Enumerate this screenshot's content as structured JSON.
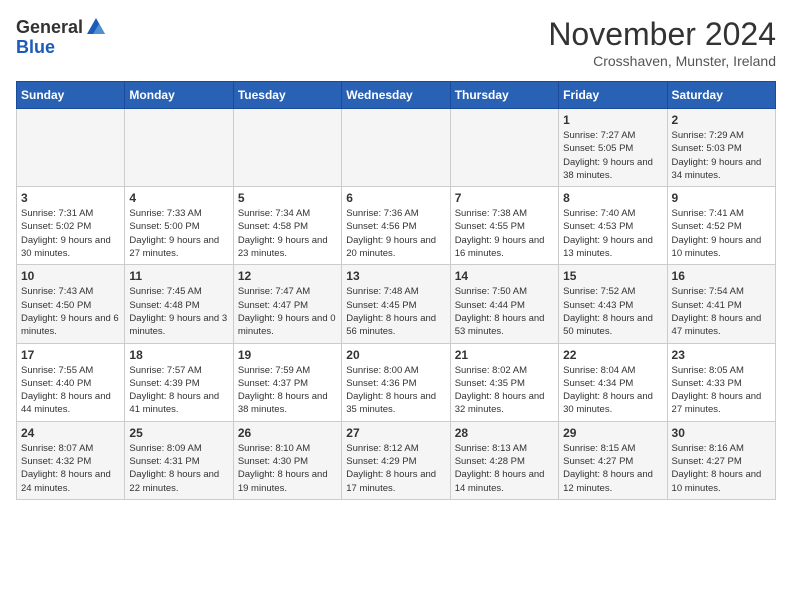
{
  "logo": {
    "general": "General",
    "blue": "Blue"
  },
  "title": "November 2024",
  "subtitle": "Crosshaven, Munster, Ireland",
  "headers": [
    "Sunday",
    "Monday",
    "Tuesday",
    "Wednesday",
    "Thursday",
    "Friday",
    "Saturday"
  ],
  "weeks": [
    [
      {
        "day": "",
        "info": ""
      },
      {
        "day": "",
        "info": ""
      },
      {
        "day": "",
        "info": ""
      },
      {
        "day": "",
        "info": ""
      },
      {
        "day": "",
        "info": ""
      },
      {
        "day": "1",
        "info": "Sunrise: 7:27 AM\nSunset: 5:05 PM\nDaylight: 9 hours and 38 minutes."
      },
      {
        "day": "2",
        "info": "Sunrise: 7:29 AM\nSunset: 5:03 PM\nDaylight: 9 hours and 34 minutes."
      }
    ],
    [
      {
        "day": "3",
        "info": "Sunrise: 7:31 AM\nSunset: 5:02 PM\nDaylight: 9 hours and 30 minutes."
      },
      {
        "day": "4",
        "info": "Sunrise: 7:33 AM\nSunset: 5:00 PM\nDaylight: 9 hours and 27 minutes."
      },
      {
        "day": "5",
        "info": "Sunrise: 7:34 AM\nSunset: 4:58 PM\nDaylight: 9 hours and 23 minutes."
      },
      {
        "day": "6",
        "info": "Sunrise: 7:36 AM\nSunset: 4:56 PM\nDaylight: 9 hours and 20 minutes."
      },
      {
        "day": "7",
        "info": "Sunrise: 7:38 AM\nSunset: 4:55 PM\nDaylight: 9 hours and 16 minutes."
      },
      {
        "day": "8",
        "info": "Sunrise: 7:40 AM\nSunset: 4:53 PM\nDaylight: 9 hours and 13 minutes."
      },
      {
        "day": "9",
        "info": "Sunrise: 7:41 AM\nSunset: 4:52 PM\nDaylight: 9 hours and 10 minutes."
      }
    ],
    [
      {
        "day": "10",
        "info": "Sunrise: 7:43 AM\nSunset: 4:50 PM\nDaylight: 9 hours and 6 minutes."
      },
      {
        "day": "11",
        "info": "Sunrise: 7:45 AM\nSunset: 4:48 PM\nDaylight: 9 hours and 3 minutes."
      },
      {
        "day": "12",
        "info": "Sunrise: 7:47 AM\nSunset: 4:47 PM\nDaylight: 9 hours and 0 minutes."
      },
      {
        "day": "13",
        "info": "Sunrise: 7:48 AM\nSunset: 4:45 PM\nDaylight: 8 hours and 56 minutes."
      },
      {
        "day": "14",
        "info": "Sunrise: 7:50 AM\nSunset: 4:44 PM\nDaylight: 8 hours and 53 minutes."
      },
      {
        "day": "15",
        "info": "Sunrise: 7:52 AM\nSunset: 4:43 PM\nDaylight: 8 hours and 50 minutes."
      },
      {
        "day": "16",
        "info": "Sunrise: 7:54 AM\nSunset: 4:41 PM\nDaylight: 8 hours and 47 minutes."
      }
    ],
    [
      {
        "day": "17",
        "info": "Sunrise: 7:55 AM\nSunset: 4:40 PM\nDaylight: 8 hours and 44 minutes."
      },
      {
        "day": "18",
        "info": "Sunrise: 7:57 AM\nSunset: 4:39 PM\nDaylight: 8 hours and 41 minutes."
      },
      {
        "day": "19",
        "info": "Sunrise: 7:59 AM\nSunset: 4:37 PM\nDaylight: 8 hours and 38 minutes."
      },
      {
        "day": "20",
        "info": "Sunrise: 8:00 AM\nSunset: 4:36 PM\nDaylight: 8 hours and 35 minutes."
      },
      {
        "day": "21",
        "info": "Sunrise: 8:02 AM\nSunset: 4:35 PM\nDaylight: 8 hours and 32 minutes."
      },
      {
        "day": "22",
        "info": "Sunrise: 8:04 AM\nSunset: 4:34 PM\nDaylight: 8 hours and 30 minutes."
      },
      {
        "day": "23",
        "info": "Sunrise: 8:05 AM\nSunset: 4:33 PM\nDaylight: 8 hours and 27 minutes."
      }
    ],
    [
      {
        "day": "24",
        "info": "Sunrise: 8:07 AM\nSunset: 4:32 PM\nDaylight: 8 hours and 24 minutes."
      },
      {
        "day": "25",
        "info": "Sunrise: 8:09 AM\nSunset: 4:31 PM\nDaylight: 8 hours and 22 minutes."
      },
      {
        "day": "26",
        "info": "Sunrise: 8:10 AM\nSunset: 4:30 PM\nDaylight: 8 hours and 19 minutes."
      },
      {
        "day": "27",
        "info": "Sunrise: 8:12 AM\nSunset: 4:29 PM\nDaylight: 8 hours and 17 minutes."
      },
      {
        "day": "28",
        "info": "Sunrise: 8:13 AM\nSunset: 4:28 PM\nDaylight: 8 hours and 14 minutes."
      },
      {
        "day": "29",
        "info": "Sunrise: 8:15 AM\nSunset: 4:27 PM\nDaylight: 8 hours and 12 minutes."
      },
      {
        "day": "30",
        "info": "Sunrise: 8:16 AM\nSunset: 4:27 PM\nDaylight: 8 hours and 10 minutes."
      }
    ]
  ]
}
